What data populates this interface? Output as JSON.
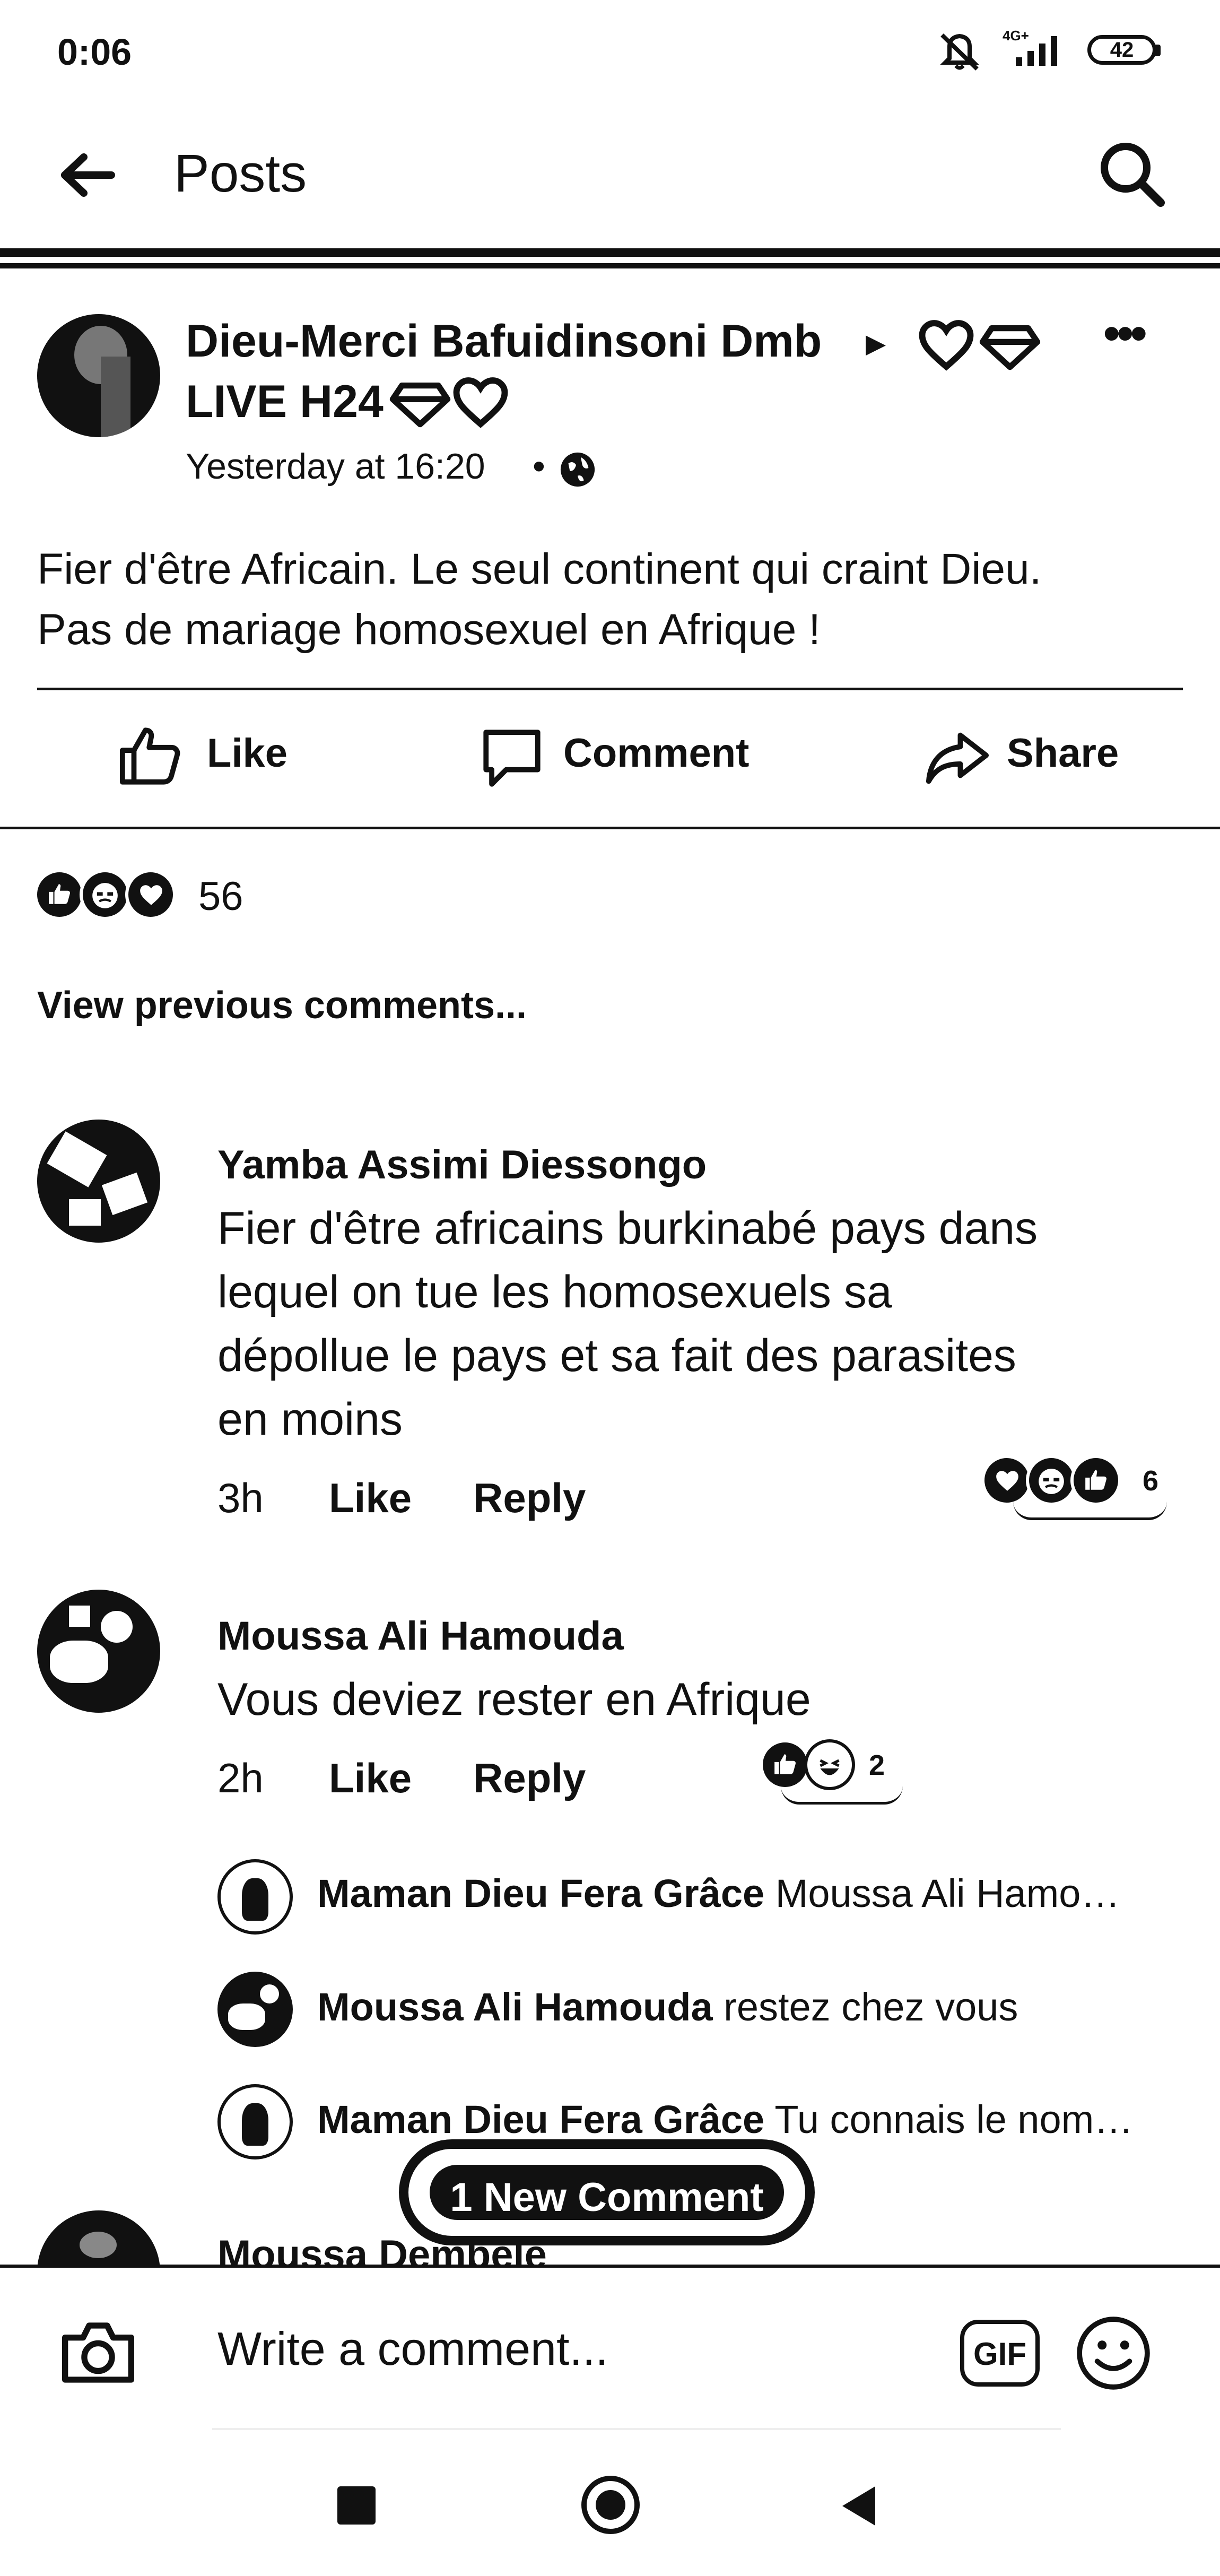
{
  "status_bar": {
    "time": "0:06",
    "network": "4G+",
    "battery": "42"
  },
  "header": {
    "title": "Posts"
  },
  "post": {
    "author_line1": "Dieu-Merci Bafuidinsoni Dmb",
    "arrow": "▸",
    "author_line2": "LIVE H24",
    "timestamp": "Yesterday at 16:20",
    "separator": "•",
    "text_line1": "Fier d'être Africain. Le seul continent qui craint Dieu.",
    "text_line2": "Pas de mariage homosexuel en Afrique !",
    "actions": {
      "like": "Like",
      "comment": "Comment",
      "share": "Share"
    },
    "reaction_count": "56"
  },
  "comments": {
    "view_previous": "View previous comments...",
    "items": [
      {
        "author": "Yamba Assimi Diessongo",
        "lines": [
          "Fier d'être africains burkinabé pays dans",
          "lequel on tue les homosexuels sa",
          "dépollue le pays et sa fait des parasites",
          "en moins"
        ],
        "time": "3h",
        "like": "Like",
        "reply": "Reply",
        "reaction_count": "6"
      },
      {
        "author": "Moussa Ali Hamouda",
        "text": "Vous deviez rester en Afrique",
        "time": "2h",
        "like": "Like",
        "reply": "Reply",
        "reaction_count": "2"
      }
    ],
    "replies": [
      {
        "author": "Maman Dieu Fera Grâce",
        "text": "Moussa Ali Hamo…"
      },
      {
        "author": "Moussa Ali Hamouda",
        "text": "restez chez vous"
      },
      {
        "author": "Maman Dieu Fera Grâce",
        "text": "Tu connais le nom…"
      }
    ],
    "partial_author": "Moussa Dembele",
    "new_comment_pill": "1 New Comment"
  },
  "composer": {
    "placeholder": "Write a comment...",
    "gif_label": "GIF"
  },
  "colors": {
    "ink": "#111111",
    "background": "#ffffff"
  }
}
